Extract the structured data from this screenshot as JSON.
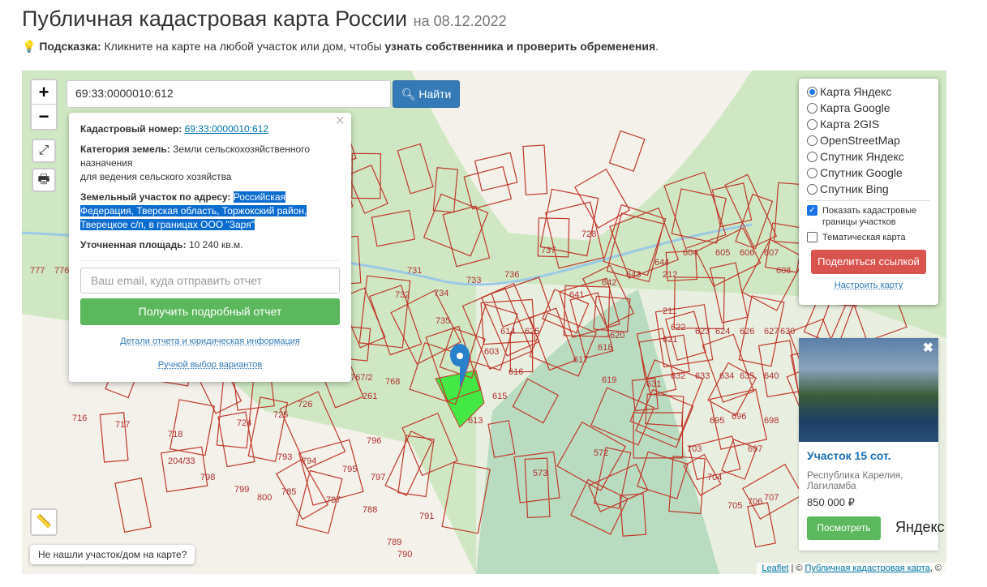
{
  "header": {
    "title": "Публичная кадастровая карта России",
    "date": "на 08.12.2022"
  },
  "hint": {
    "label": "Подсказка:",
    "text": " Кликните на карте на любой участок или дом, чтобы ",
    "bold": "узнать собственника и проверить обременения",
    "end": "."
  },
  "map": {
    "zoom_in": "+",
    "zoom_out": "−",
    "search": {
      "value": "69:33:0000010:612",
      "button": "Найти"
    },
    "popup": {
      "cad_label": "Кадастровый номер:",
      "cad_value": "69:33:0000010:612",
      "cat_label": "Категория земель:",
      "cat_value": "Земли сельскохозяйственного назначения",
      "use": "для ведения сельского хозяйства",
      "addr_label": "Земельный участок по адресу:",
      "addr_value": "Российская Федерация, Тверская область, Торжокский район, Тверецкое с/п, в границах ООО \"Заря\"",
      "area_label": "Уточненная площадь:",
      "area_value": "10 240 кв.м.",
      "email_placeholder": "Ваш email, куда отправить отчет",
      "report_button": "Получить подробный отчет",
      "details_link": "Детали отчета и юридическая информация",
      "manual_link": "Ручной выбор вариантов"
    },
    "layers": {
      "options": [
        "Карта Яндекс",
        "Карта Google",
        "Карта 2GIS",
        "OpenStreetMap",
        "Спутник Яндекс",
        "Спутник Google",
        "Спутник Bing"
      ],
      "selected": 0,
      "show_borders": "Показать кадастровые границы участков",
      "thematic": "Тематическая карта",
      "share": "Поделиться ссылкой",
      "configure": "Настроить карту"
    },
    "ad": {
      "title": "Участок 15 сот.",
      "location": "Республика Карелия, Лагиламба",
      "price": "850 000 ₽",
      "button": "Посмотреть"
    },
    "not_found": "Не нашли участок/дом на карте?",
    "yandex_logo": "Яндекс",
    "attribution": {
      "leaflet": "Leaflet",
      "sep": " | © ",
      "pkk": "Публичная кадастровая карта",
      "end": ", ©"
    },
    "parcel_labels": [
      "731",
      "732",
      "733",
      "734",
      "735",
      "736",
      "737",
      "728",
      "603",
      "614",
      "625",
      "616",
      "615",
      "613",
      "617",
      "618",
      "619",
      "620",
      "621",
      "622",
      "623",
      "624",
      "626",
      "627",
      "630",
      "631",
      "632",
      "633",
      "634",
      "635",
      "640",
      "641",
      "642",
      "643",
      "644",
      "604",
      "605",
      "606",
      "607",
      "608",
      "212",
      "211",
      "724",
      "725",
      "726",
      "716",
      "717",
      "718",
      "204/33",
      "793",
      "794",
      "795",
      "796",
      "797",
      "798",
      "799",
      "800",
      "785",
      "787",
      "788",
      "789",
      "790",
      "791",
      "572",
      "573",
      "695",
      "696",
      "697",
      "698",
      "703",
      "704",
      "705",
      "706",
      "707",
      "767/2",
      "768",
      "261",
      "777",
      "776"
    ]
  }
}
